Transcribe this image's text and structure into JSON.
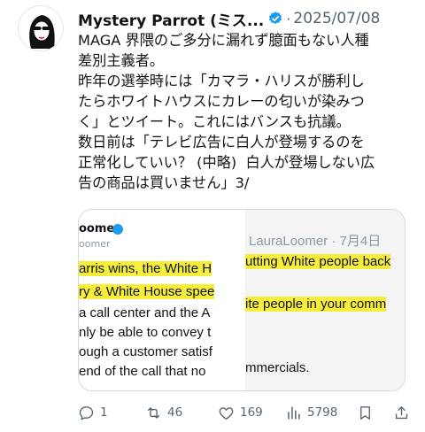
{
  "tweet": {
    "author_name": "Mystery Parrot (ミス...",
    "separator": "·",
    "date": "2025/07/08",
    "lines": [
      "MAGA 界隈のご多分に漏れず臆面もない人種",
      "差別主義者。",
      "昨年の選挙時には「カマラ・ハリスが勝利し",
      "たらホワイトハウスにカレーの匂いが染みつ",
      "く」とツイート。これにはバンスも抗議。",
      "数日前は「テレビ広告に白人が登場するのを",
      "正常化していい？ (中略)  白人が登場しない広",
      "告の商品は買いません」3/"
    ]
  },
  "media": {
    "left": {
      "name": "oomer",
      "handle": "oomer",
      "lines": [
        "arris wins, the White H",
        "ry & White House spee",
        "a call center and the A",
        "nly be able to convey t",
        "ough a customer satisf",
        " end of the call that no"
      ]
    },
    "right": {
      "header": "LauraLoomer · 7月4日",
      "lines": [
        "utting White people back",
        "ite people in your comm",
        "mmercials."
      ]
    }
  },
  "actions": {
    "replies": "1",
    "retweets": "46",
    "likes": "169",
    "views": "5798"
  },
  "colors": {
    "verified": "#1d9bf0",
    "highlight": "#f6ee3a",
    "muted": "#536471"
  },
  "icons": [
    "avatar-illustration",
    "verified-badge-icon",
    "reply-icon",
    "retweet-icon",
    "like-icon",
    "views-icon",
    "bookmark-icon",
    "share-icon"
  ]
}
